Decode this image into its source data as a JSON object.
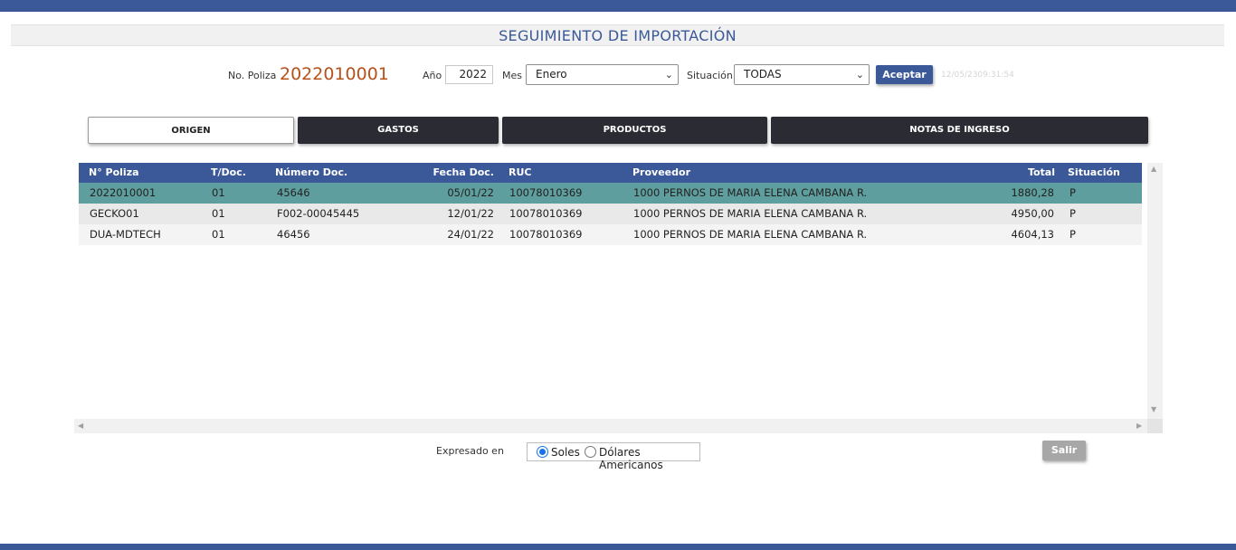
{
  "header": {
    "title": "SEGUIMIENTO DE IMPORTACIÓN"
  },
  "filters": {
    "poliza_label": "No. Poliza",
    "poliza_value": "2022010001",
    "anio_label": "Año",
    "anio_value": "2022",
    "mes_label": "Mes",
    "mes_value": "Enero",
    "situacion_label": "Situación",
    "situacion_value": "TODAS",
    "aceptar_label": "Aceptar",
    "stamp": "12/05/2309:31:54"
  },
  "tabs": [
    {
      "label": "ORIGEN",
      "active": true
    },
    {
      "label": "GASTOS",
      "active": false
    },
    {
      "label": "PRODUCTOS",
      "active": false
    },
    {
      "label": "NOTAS DE INGRESO",
      "active": false
    }
  ],
  "grid": {
    "columns": [
      "N° Poliza",
      "T/Doc.",
      "Número Doc.",
      "Fecha Doc.",
      "RUC",
      "Proveedor",
      "Total",
      "Situación"
    ],
    "rows": [
      [
        "2022010001",
        "01",
        "45646",
        "05/01/22",
        "10078010369",
        "1000 PERNOS DE MARIA ELENA CAMBANA R.",
        "1880,28",
        "P"
      ],
      [
        "GECKO01",
        "01",
        "F002-00045445",
        "12/01/22",
        "10078010369",
        "1000 PERNOS DE MARIA ELENA CAMBANA R.",
        "4950,00",
        "P"
      ],
      [
        "DUA-MDTECH",
        "01",
        "46456",
        "24/01/22",
        "10078010369",
        "1000 PERNOS DE MARIA ELENA CAMBANA R.",
        "4604,13",
        "P"
      ]
    ]
  },
  "footer": {
    "expresado_label": "Expresado en",
    "soles_label": "Soles",
    "dolares_label": "Dólares Americanos",
    "salir_label": "Salir"
  },
  "colors": {
    "brand": "#3b5998",
    "selected_row": "#5f9e9e",
    "poliza_value": "#b8501a"
  }
}
